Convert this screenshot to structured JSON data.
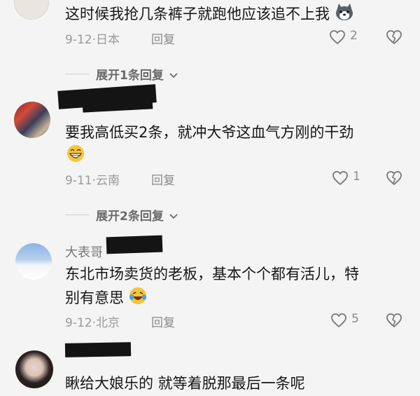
{
  "comments": [
    {
      "text": "这时候我抢几条裤子就跑他应该追不上我",
      "date": "9-12",
      "location": "日本",
      "reply_label": "回复",
      "like_count": "2",
      "emoji": "husky-dog-emoji",
      "expand_label": "展开1条回复"
    },
    {
      "text": "要我高低买2条，就冲大爷这血气方刚的干劲",
      "date": "9-11",
      "location": "云南",
      "reply_label": "回复",
      "like_count": "1",
      "emoji": "grinning-emoji",
      "expand_label": "展开2条回复"
    },
    {
      "username_partial": "大表哥",
      "text_line1": "东北市场卖货的老板，基本个个都有活儿，特",
      "text_line2": "别有意思",
      "date": "9-12",
      "location": "北京",
      "reply_label": "回复",
      "like_count": "5",
      "emoji": "laughing-tears-emoji"
    },
    {
      "text": "瞅给大娘乐的 就等着脱那最后一条呢"
    }
  ],
  "separator": "·",
  "colors": {
    "background": "#f4f4f4",
    "text": "#161616",
    "meta": "#9a9a9a",
    "redaction": "#141414"
  }
}
